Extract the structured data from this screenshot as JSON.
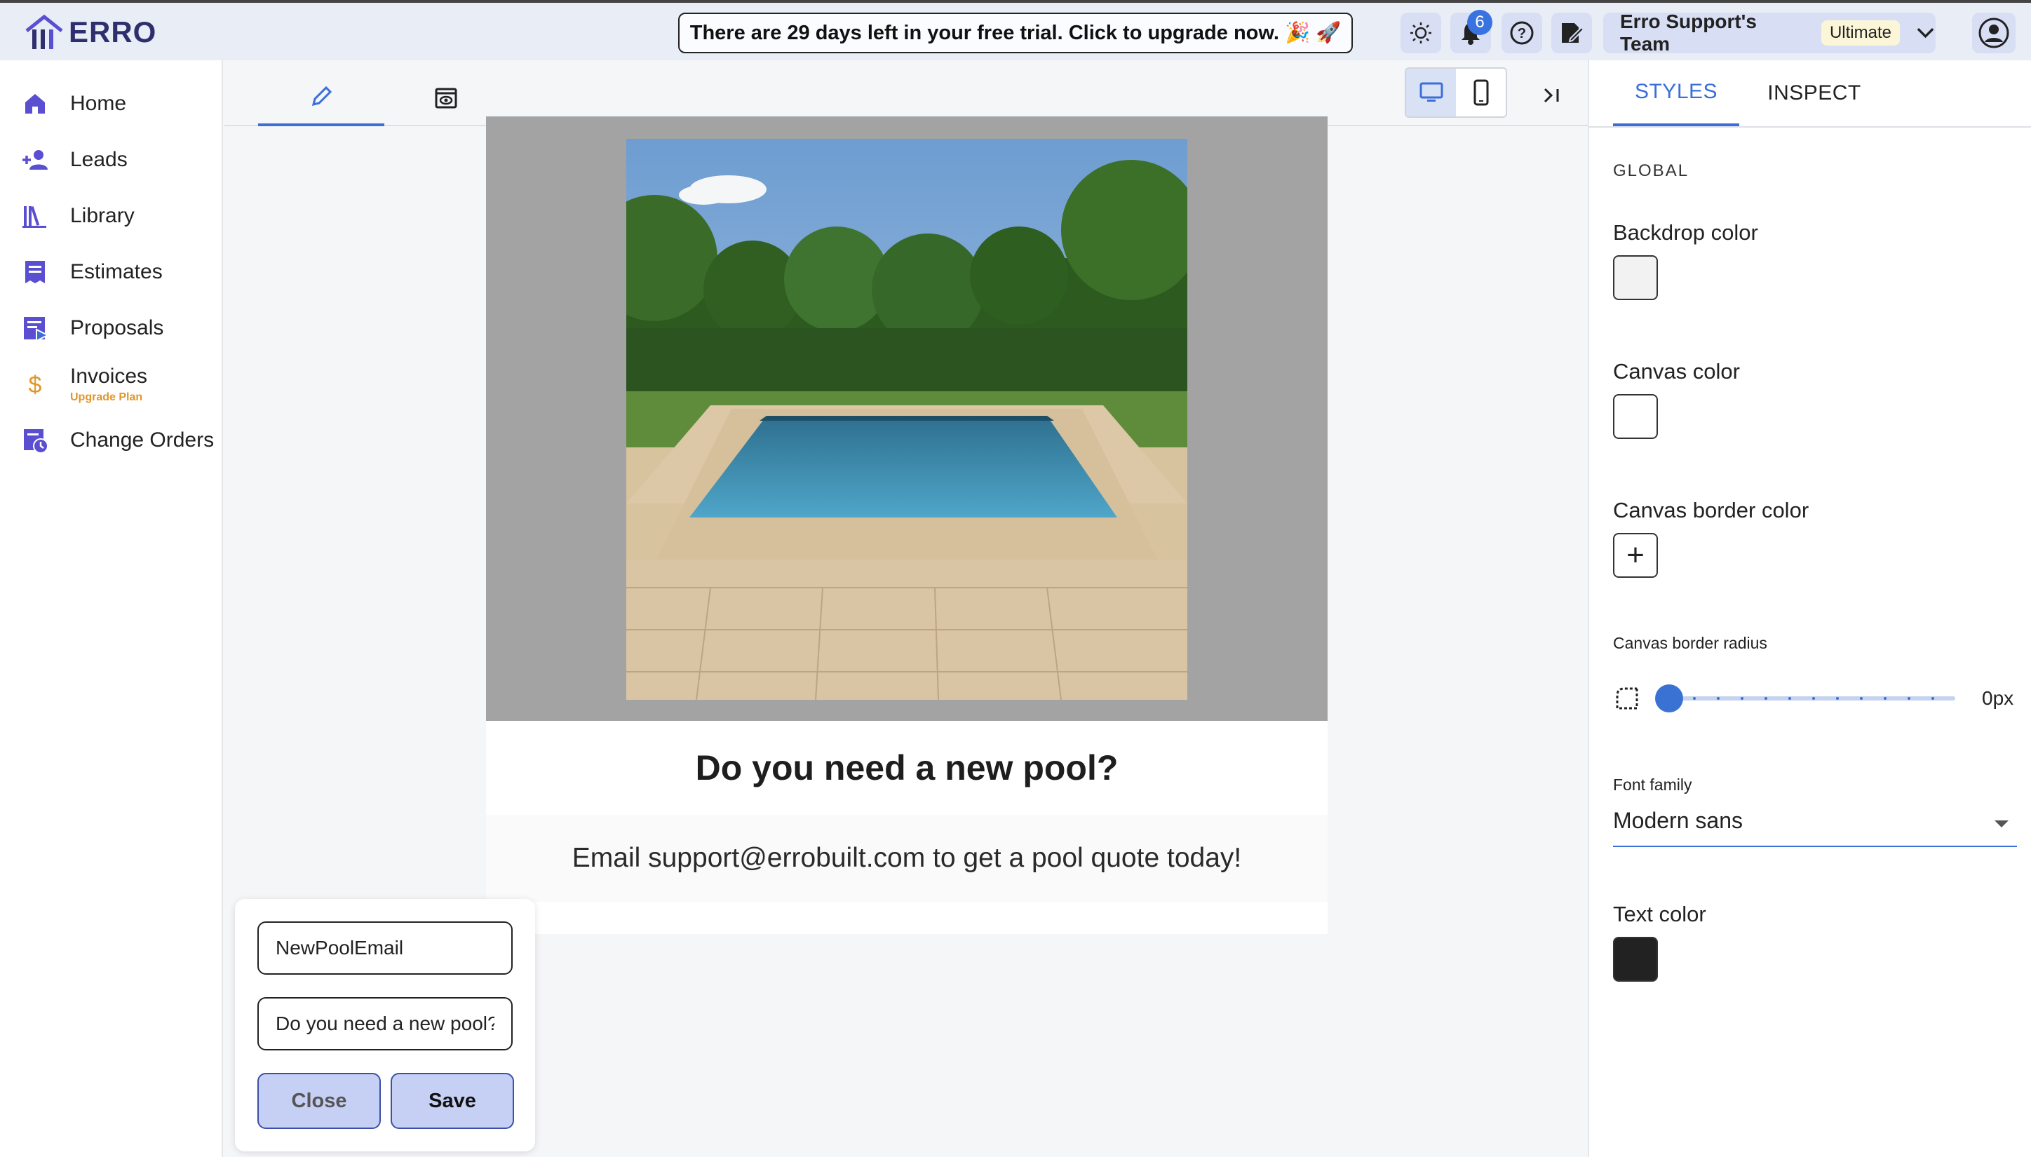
{
  "header": {
    "logo_text": "ERRO",
    "trial_banner": "There are 29 days left in your free trial. Click to upgrade now. 🎉 🚀",
    "notifications_count": "6",
    "team_name": "Erro Support's Team",
    "plan_label": "Ultimate"
  },
  "sidebar": {
    "items": [
      {
        "label": "Home",
        "icon": "home-icon"
      },
      {
        "label": "Leads",
        "icon": "add-person-icon"
      },
      {
        "label": "Library",
        "icon": "library-icon"
      },
      {
        "label": "Estimates",
        "icon": "estimates-icon"
      },
      {
        "label": "Proposals",
        "icon": "proposals-icon"
      },
      {
        "label": "Invoices",
        "sub": "Upgrade Plan",
        "icon": "dollar-icon"
      },
      {
        "label": "Change Orders",
        "icon": "change-orders-icon"
      }
    ]
  },
  "canvas": {
    "heading": "Do you need a new pool?",
    "body": "Email support@errobuilt.com to get a pool quote today!"
  },
  "popup": {
    "name_value": "NewPoolEmail",
    "subject_value": "Do you need a new pool?",
    "close_label": "Close",
    "save_label": "Save"
  },
  "panel": {
    "tabs": [
      "STYLES",
      "INSPECT"
    ],
    "section": "GLOBAL",
    "backdrop_label": "Backdrop color",
    "backdrop_color": "#f2f2f2",
    "canvas_label": "Canvas color",
    "canvas_color": "#ffffff",
    "border_color_label": "Canvas border color",
    "radius_label": "Canvas border radius",
    "radius_value": "0px",
    "font_label": "Font family",
    "font_value": "Modern sans",
    "text_color_label": "Text color",
    "text_color": "#222222"
  },
  "colors": {
    "accent": "#3a6fd8",
    "brand": "#5a4fd1",
    "upgrade": "#e0962b"
  }
}
